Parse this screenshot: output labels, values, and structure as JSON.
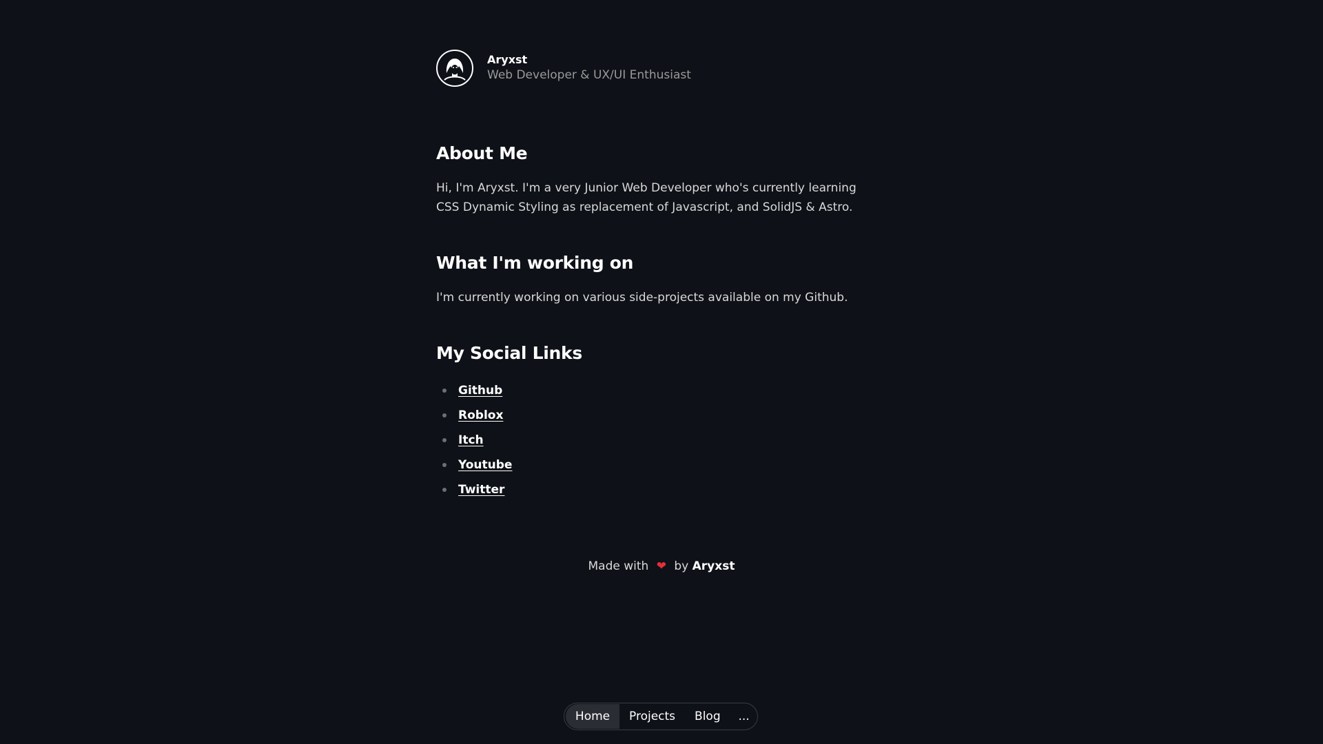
{
  "profile": {
    "name": "Aryxst",
    "role": "Web Developer & UX/UI Enthusiast"
  },
  "about": {
    "heading": "About Me",
    "text": "Hi, I'm Aryxst. I'm a very Junior Web Developer who's currently learning CSS Dynamic Styling as replacement of Javascript, and SolidJS & Astro."
  },
  "work": {
    "heading": "What I'm working on",
    "text": "I'm currently working on various side-projects available on my Github."
  },
  "social": {
    "heading": "My Social Links",
    "links": [
      {
        "label": "Github"
      },
      {
        "label": "Roblox"
      },
      {
        "label": "Itch"
      },
      {
        "label": "Youtube"
      },
      {
        "label": "Twitter"
      }
    ]
  },
  "footer": {
    "prefix": "Made with",
    "heart_icon": "heart-icon",
    "by": "by",
    "author": "Aryxst"
  },
  "nav": {
    "items": [
      {
        "label": "Home",
        "active": true
      },
      {
        "label": "Projects",
        "active": false
      },
      {
        "label": "Blog",
        "active": false
      }
    ],
    "more": "..."
  },
  "colors": {
    "background": "#0e1117",
    "text": "#d9d9d9",
    "heading": "#ffffff",
    "muted": "#9a9a9a",
    "heart": "#e0303b",
    "nav_active": "#2a2d33"
  }
}
